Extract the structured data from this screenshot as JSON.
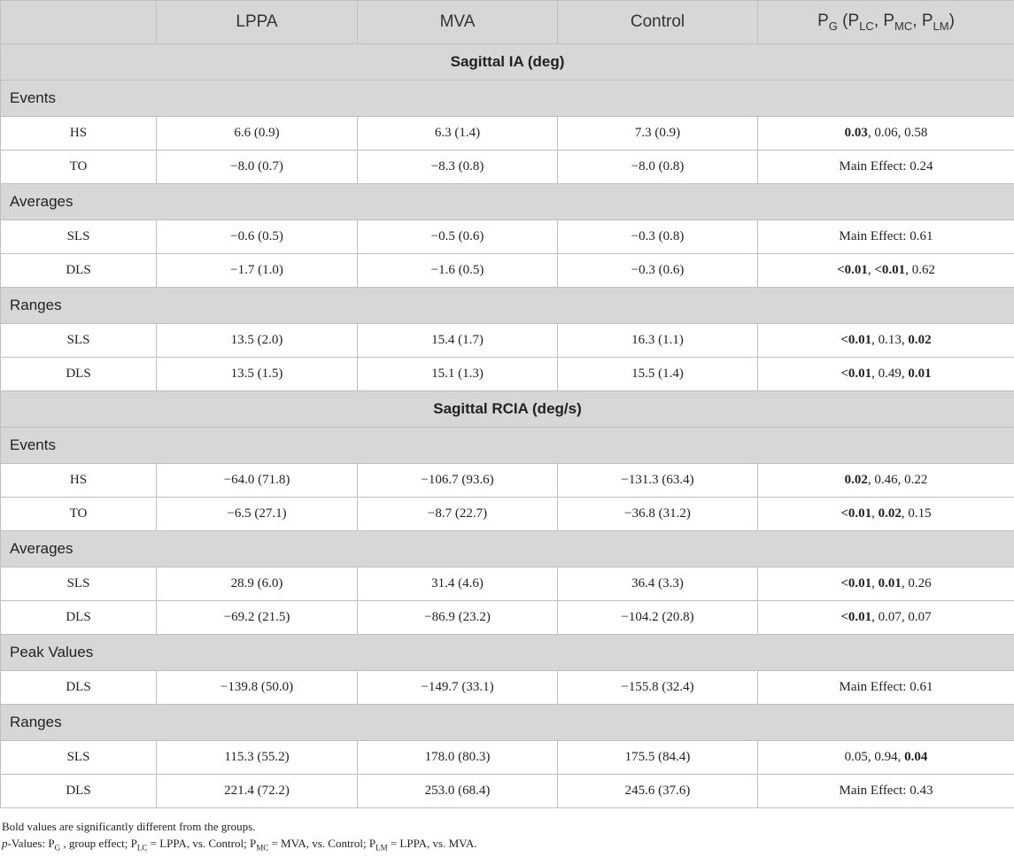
{
  "header": {
    "col0": "",
    "col1": "LPPA",
    "col2": "MVA",
    "col3": "Control",
    "pcol": {
      "p1": "P",
      "s1": "G",
      "p2": " (P",
      "s2": "LC",
      "p3": ", P",
      "s3": "MC",
      "p4": ", P",
      "s4": "LM",
      "p5": ")"
    }
  },
  "sections": [
    {
      "title": "Sagittal IA (deg)",
      "groups": [
        {
          "title": "Events",
          "rows": [
            {
              "label": "HS",
              "lppa": "6.6 (0.9)",
              "mva": "6.3 (1.4)",
              "control": "7.3 (0.9)",
              "p": [
                {
                  "t": "0.03",
                  "b": true
                },
                {
                  "t": ", 0.06, 0.58",
                  "b": false
                }
              ]
            },
            {
              "label": "TO",
              "lppa": "−8.0 (0.7)",
              "mva": "−8.3 (0.8)",
              "control": "−8.0 (0.8)",
              "p": [
                {
                  "t": "Main Effect: 0.24",
                  "b": false
                }
              ]
            }
          ]
        },
        {
          "title": "Averages",
          "rows": [
            {
              "label": "SLS",
              "lppa": "−0.6 (0.5)",
              "mva": "−0.5 (0.6)",
              "control": "−0.3 (0.8)",
              "p": [
                {
                  "t": "Main Effect: 0.61",
                  "b": false
                }
              ]
            },
            {
              "label": "DLS",
              "lppa": "−1.7 (1.0)",
              "mva": "−1.6 (0.5)",
              "control": "−0.3 (0.6)",
              "p": [
                {
                  "t": "<0.01",
                  "b": true
                },
                {
                  "t": ", ",
                  "b": false
                },
                {
                  "t": "<0.01",
                  "b": true
                },
                {
                  "t": ", 0.62",
                  "b": false
                }
              ]
            }
          ]
        },
        {
          "title": "Ranges",
          "rows": [
            {
              "label": "SLS",
              "lppa": "13.5 (2.0)",
              "mva": "15.4 (1.7)",
              "control": "16.3 (1.1)",
              "p": [
                {
                  "t": "<0.01",
                  "b": true
                },
                {
                  "t": ", 0.13, ",
                  "b": false
                },
                {
                  "t": "0.02",
                  "b": true
                }
              ]
            },
            {
              "label": "DLS",
              "lppa": "13.5 (1.5)",
              "mva": "15.1 (1.3)",
              "control": "15.5 (1.4)",
              "p": [
                {
                  "t": "<0.01",
                  "b": true
                },
                {
                  "t": ", 0.49, ",
                  "b": false
                },
                {
                  "t": "0.01",
                  "b": true
                }
              ]
            }
          ]
        }
      ]
    },
    {
      "title": "Sagittal RCIA (deg/s)",
      "groups": [
        {
          "title": "Events",
          "rows": [
            {
              "label": "HS",
              "lppa": "−64.0 (71.8)",
              "mva": "−106.7 (93.6)",
              "control": "−131.3 (63.4)",
              "p": [
                {
                  "t": "0.02",
                  "b": true
                },
                {
                  "t": ", 0.46, 0.22",
                  "b": false
                }
              ]
            },
            {
              "label": "TO",
              "lppa": "−6.5 (27.1)",
              "mva": "−8.7 (22.7)",
              "control": "−36.8 (31.2)",
              "p": [
                {
                  "t": "<0.01",
                  "b": true
                },
                {
                  "t": ", ",
                  "b": false
                },
                {
                  "t": "0.02",
                  "b": true
                },
                {
                  "t": ", 0.15",
                  "b": false
                }
              ]
            }
          ]
        },
        {
          "title": "Averages",
          "rows": [
            {
              "label": "SLS",
              "lppa": "28.9 (6.0)",
              "mva": "31.4 (4.6)",
              "control": "36.4 (3.3)",
              "p": [
                {
                  "t": "<0.01",
                  "b": true
                },
                {
                  "t": ", ",
                  "b": false
                },
                {
                  "t": "0.01",
                  "b": true
                },
                {
                  "t": ", 0.26",
                  "b": false
                }
              ]
            },
            {
              "label": "DLS",
              "lppa": "−69.2 (21.5)",
              "mva": "−86.9 (23.2)",
              "control": "−104.2 (20.8)",
              "p": [
                {
                  "t": "<0.01",
                  "b": true
                },
                {
                  "t": ", 0.07, 0.07",
                  "b": false
                }
              ]
            }
          ]
        },
        {
          "title": "Peak Values",
          "rows": [
            {
              "label": "DLS",
              "lppa": "−139.8 (50.0)",
              "mva": "−149.7 (33.1)",
              "control": "−155.8 (32.4)",
              "p": [
                {
                  "t": "Main Effect: 0.61",
                  "b": false
                }
              ]
            }
          ]
        },
        {
          "title": "Ranges",
          "rows": [
            {
              "label": "SLS",
              "lppa": "115.3 (55.2)",
              "mva": "178.0 (80.3)",
              "control": "175.5 (84.4)",
              "p": [
                {
                  "t": "0.05, 0.94, ",
                  "b": false
                },
                {
                  "t": "0.04",
                  "b": true
                }
              ]
            },
            {
              "label": "DLS",
              "lppa": "221.4 (72.2)",
              "mva": "253.0 (68.4)",
              "control": "245.6 (37.6)",
              "p": [
                {
                  "t": "Main Effect: 0.43",
                  "b": false
                }
              ]
            }
          ]
        }
      ]
    }
  ],
  "footnotes": {
    "line1": "Bold values are significantly different from the groups.",
    "line2": {
      "italic": "p",
      "parts": [
        {
          "t": "-Values: P"
        },
        {
          "sub": "G"
        },
        {
          "t": " , group effect; P"
        },
        {
          "sub": "LC"
        },
        {
          "t": " = LPPA, vs. Control; P"
        },
        {
          "sub": "MC"
        },
        {
          "t": " = MVA, vs. Control; P"
        },
        {
          "sub": "LM"
        },
        {
          "t": " = LPPA, vs. MVA."
        }
      ]
    }
  }
}
